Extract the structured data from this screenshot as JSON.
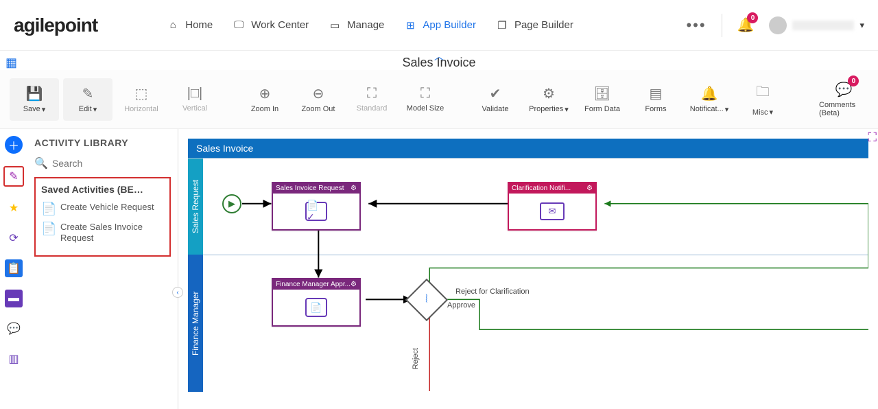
{
  "brand": "agilepoint",
  "nav": {
    "items": [
      {
        "label": "Home"
      },
      {
        "label": "Work Center"
      },
      {
        "label": "Manage"
      },
      {
        "label": "App Builder"
      },
      {
        "label": "Page Builder"
      }
    ]
  },
  "notifications": {
    "count": "0"
  },
  "subheader": {
    "title": "Sales Invoice"
  },
  "toolbar": {
    "save": "Save",
    "edit": "Edit",
    "horizontal": "Horizontal",
    "vertical": "Vertical",
    "zoom_in": "Zoom In",
    "zoom_out": "Zoom Out",
    "standard": "Standard",
    "model_size": "Model Size",
    "validate": "Validate",
    "properties": "Properties",
    "form_data": "Form Data",
    "forms": "Forms",
    "notifications": "Notificat...",
    "misc": "Misc",
    "comments": "Comments (Beta)",
    "comments_count": "0"
  },
  "sidepanel": {
    "title": "ACTIVITY LIBRARY",
    "search_placeholder": "Search",
    "saved_title": "Saved Activities (BE…",
    "items": [
      {
        "label": "Create Vehicle Request"
      },
      {
        "label": "Create Sales Invoice Request"
      }
    ]
  },
  "canvas": {
    "title": "Sales Invoice",
    "lanes": [
      {
        "label": "Sales Request"
      },
      {
        "label": "Finance Manager"
      }
    ],
    "activities": {
      "a1": "Sales Invoice Request",
      "a2": "Clarification Notifi...",
      "a3": "Finance Manager Appr..."
    },
    "edges": {
      "reject_clar": "Reject for Clarification",
      "approve": "Approve",
      "reject": "Reject"
    }
  }
}
